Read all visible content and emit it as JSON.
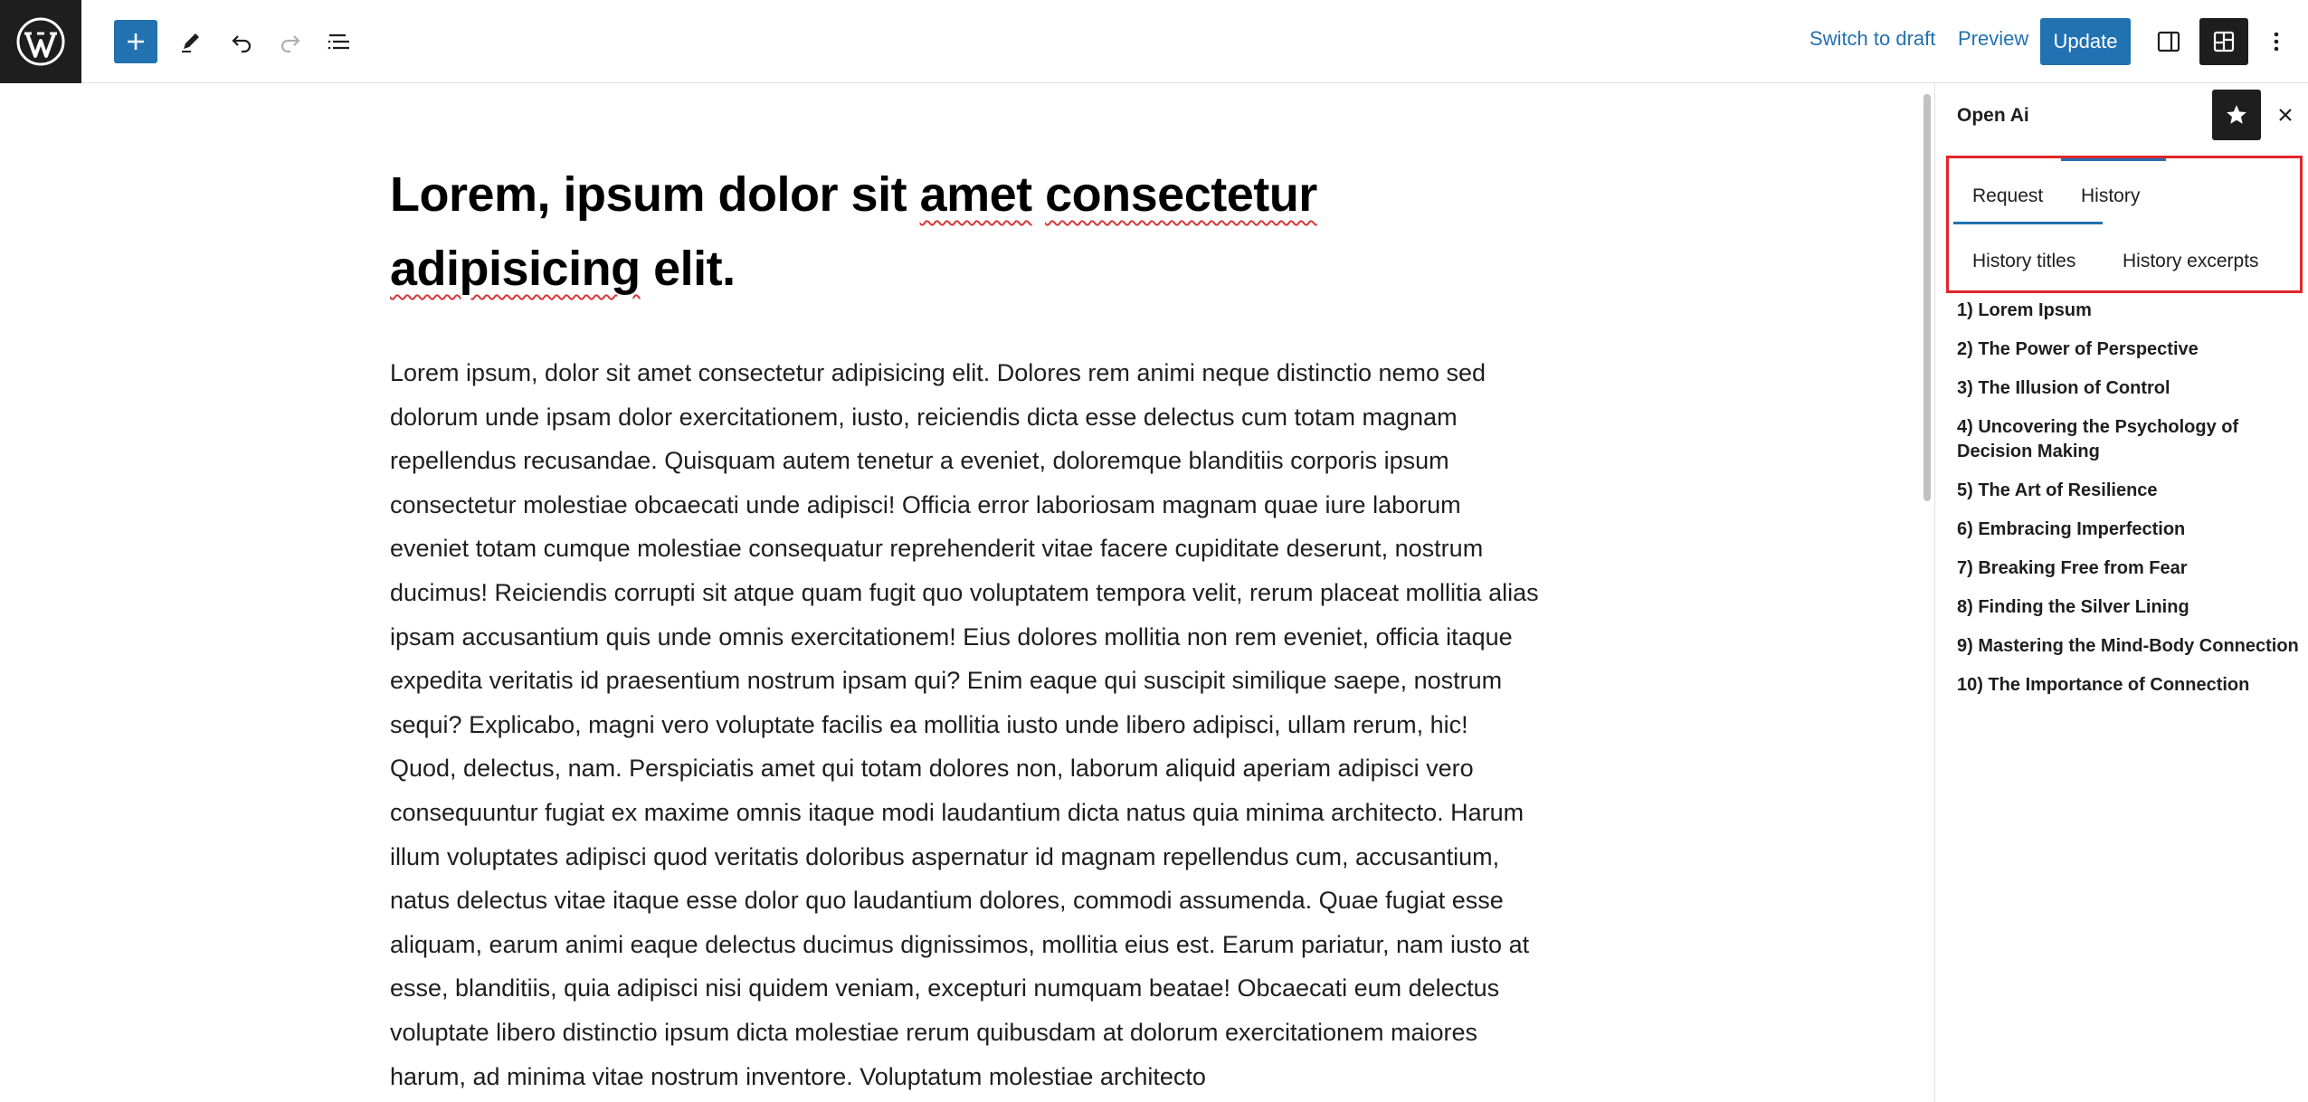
{
  "toolbar": {
    "switch_to_draft": "Switch to draft",
    "preview": "Preview",
    "update": "Update"
  },
  "post": {
    "title_part1": "Lorem, ipsum dolor sit ",
    "title_spell1": "amet",
    "title_space": " ",
    "title_spell2": "consectetur",
    "title_spell3": "adipisicing",
    "title_part2": " elit.",
    "body": "Lorem ipsum, dolor sit amet consectetur adipisicing elit. Dolores rem animi neque distinctio nemo sed dolorum unde ipsam dolor exercitationem, iusto, reiciendis dicta esse delectus cum totam magnam repellendus recusandae. Quisquam autem tenetur a eveniet, doloremque blanditiis corporis ipsum consectetur molestiae obcaecati unde adipisci! Officia error laboriosam magnam quae iure laborum eveniet totam cumque molestiae consequatur reprehenderit vitae facere cupiditate deserunt, nostrum ducimus! Reiciendis corrupti sit atque quam fugit quo voluptatem tempora velit, rerum placeat mollitia alias ipsam accusantium quis unde omnis exercitationem! Eius dolores mollitia non rem eveniet, officia itaque expedita veritatis id praesentium nostrum ipsam qui? Enim eaque qui suscipit similique saepe, nostrum sequi? Explicabo, magni vero voluptate facilis ea mollitia iusto unde libero adipisci, ullam rerum, hic! Quod, delectus, nam. Perspiciatis amet qui totam dolores non, laborum aliquid aperiam adipisci vero consequuntur fugiat ex maxime omnis itaque modi laudantium dicta natus quia minima architecto. Harum illum voluptates adipisci quod veritatis doloribus aspernatur id magnam repellendus cum, accusantium, natus delectus vitae itaque esse dolor quo laudantium dolores, commodi assumenda. Quae fugiat esse aliquam, earum animi eaque delectus ducimus dignissimos, mollitia eius est. Earum pariatur, nam iusto at esse, blanditiis, quia adipisci nisi quidem veniam, excepturi numquam beatae! Obcaecati eum delectus voluptate libero distinctio ipsum dicta molestiae rerum quibusdam at dolorum exercitationem maiores harum, ad minima vitae nostrum inventore. Voluptatum molestiae architecto"
  },
  "sidebar": {
    "title": "Open Ai",
    "tabs": {
      "request": "Request",
      "history": "History",
      "history_titles": "History titles",
      "history_excerpts": "History excerpts"
    },
    "history_items": [
      "1) Lorem Ipsum",
      "2) The Power of Perspective",
      "3) The Illusion of Control",
      "4) Uncovering the Psychology of Decision Making",
      "5) The Art of Resilience",
      "6) Embracing Imperfection",
      "7) Breaking Free from Fear",
      "8) Finding the Silver Lining",
      "9) Mastering the Mind-Body Connection",
      "10) The Importance of Connection"
    ]
  },
  "icons": {
    "logo": "wordpress-logo",
    "add": "plus-icon",
    "tools": "pencil-icon",
    "undo": "undo-icon",
    "redo": "redo-icon",
    "outline": "list-view-icon",
    "settings": "sidebar-toggle-icon",
    "plugin": "plugin-icon",
    "options": "more-vertical-icon",
    "pin": "star-icon",
    "close": "close-icon"
  },
  "colors": {
    "accent": "#2271b1",
    "dark": "#1e1e1e",
    "highlight_border": "#e0252b",
    "spellcheck": "#d63638"
  }
}
